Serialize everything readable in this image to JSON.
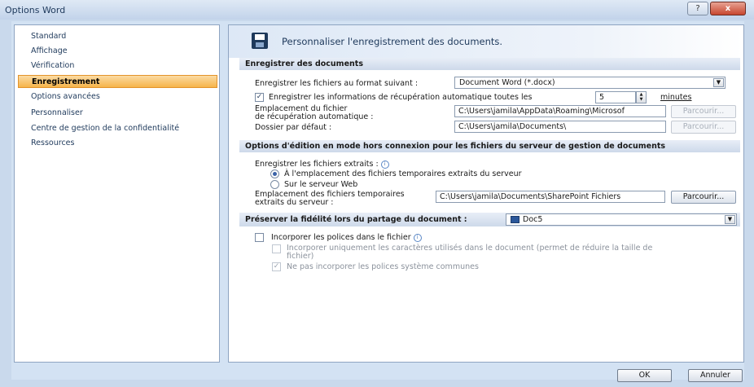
{
  "window": {
    "title": "Options Word",
    "help_label": "?",
    "close_label": "x"
  },
  "sidebar": {
    "items": [
      {
        "label": "Standard"
      },
      {
        "label": "Affichage"
      },
      {
        "label": "Vérification"
      },
      {
        "label": "Enregistrement",
        "selected": true
      },
      {
        "label": "Options avancées"
      },
      {
        "label": "Personnaliser"
      },
      {
        "label": "Centre de gestion de la confidentialité"
      },
      {
        "label": "Ressources"
      }
    ]
  },
  "header": {
    "title": "Personnaliser l'enregistrement des documents.",
    "icon": "floppy-disk-icon"
  },
  "save_section": {
    "title": "Enregistrer des documents",
    "format_label": "Enregistrer les fichiers au format suivant :",
    "format_value": "Document Word (*.docx)",
    "autorecover_label": "Enregistrer les informations de récupération automatique toutes les",
    "autorecover_checked": true,
    "autorecover_minutes": "5",
    "minutes_label": "minutes",
    "autorecover_location_label_1": "Emplacement du fichier",
    "autorecover_location_label_2": "de récupération automatique :",
    "autorecover_location_value": "C:\\Users\\jamila\\AppData\\Roaming\\Microsof",
    "browse_label": "Parcourir...",
    "default_folder_label": "Dossier par défaut :",
    "default_folder_value": "C:\\Users\\jamila\\Documents\\"
  },
  "offline_section": {
    "title": "Options d'édition en mode hors connexion pour les fichiers du serveur de gestion de documents",
    "save_extracted_label": "Enregistrer les fichiers extraits :",
    "radio_temp_label": "À l'emplacement des fichiers temporaires extraits du serveur",
    "radio_web_label": "Sur le serveur Web",
    "radio_selected": "temp",
    "temp_location_label_1": "Emplacement des fichiers temporaires",
    "temp_location_label_2": "extraits du serveur :",
    "temp_location_value": "C:\\Users\\jamila\\Documents\\SharePoint Fichiers",
    "browse_label": "Parcourir..."
  },
  "fidelity_section": {
    "title": "Préserver la fidélité lors du partage du document :",
    "document_value": "Doc5",
    "embed_fonts_label": "Incorporer les polices dans le fichier",
    "embed_fonts_checked": false,
    "embed_used_chars_label": "Incorporer uniquement les caractères utilisés dans le document (permet de réduire la taille de",
    "embed_used_chars_label_2": "fichier)",
    "embed_used_chars_checked": false,
    "no_system_fonts_label": "Ne pas incorporer les polices système communes",
    "no_system_fonts_checked": true
  },
  "footer": {
    "ok_label": "OK",
    "cancel_label": "Annuler"
  },
  "colors": {
    "selection": "#f6b44a",
    "section_header": "#cdd9ea",
    "frame": "#d3e2f3"
  }
}
